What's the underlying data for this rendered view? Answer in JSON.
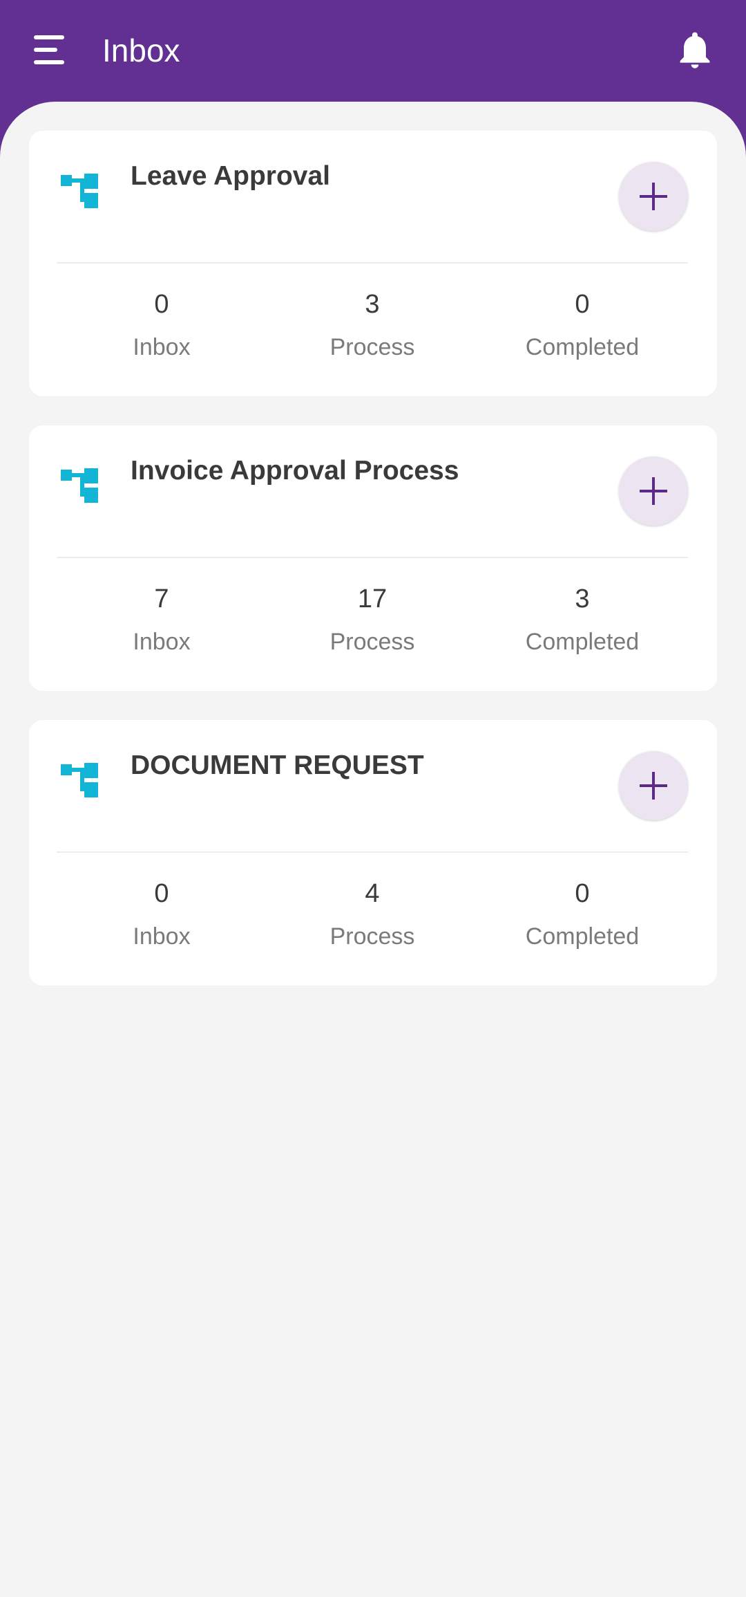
{
  "header": {
    "title": "Inbox",
    "background_color": "#613092"
  },
  "theme": {
    "accent": "#5b2a86",
    "icon_color": "#12b5d6",
    "add_button_bg": "#ece5f1"
  },
  "cards": [
    {
      "title": "Leave Approval",
      "stats": [
        {
          "value": "0",
          "label": "Inbox"
        },
        {
          "value": "3",
          "label": "Process"
        },
        {
          "value": "0",
          "label": "Completed"
        }
      ]
    },
    {
      "title": "Invoice Approval Process",
      "stats": [
        {
          "value": "7",
          "label": "Inbox"
        },
        {
          "value": "17",
          "label": "Process"
        },
        {
          "value": "3",
          "label": "Completed"
        }
      ]
    },
    {
      "title": "DOCUMENT REQUEST",
      "stats": [
        {
          "value": "0",
          "label": "Inbox"
        },
        {
          "value": "4",
          "label": "Process"
        },
        {
          "value": "0",
          "label": "Completed"
        }
      ]
    }
  ],
  "icons": {
    "menu": "menu-icon",
    "notifications": "bell-icon",
    "workflow": "workflow-icon",
    "add": "plus-icon"
  }
}
